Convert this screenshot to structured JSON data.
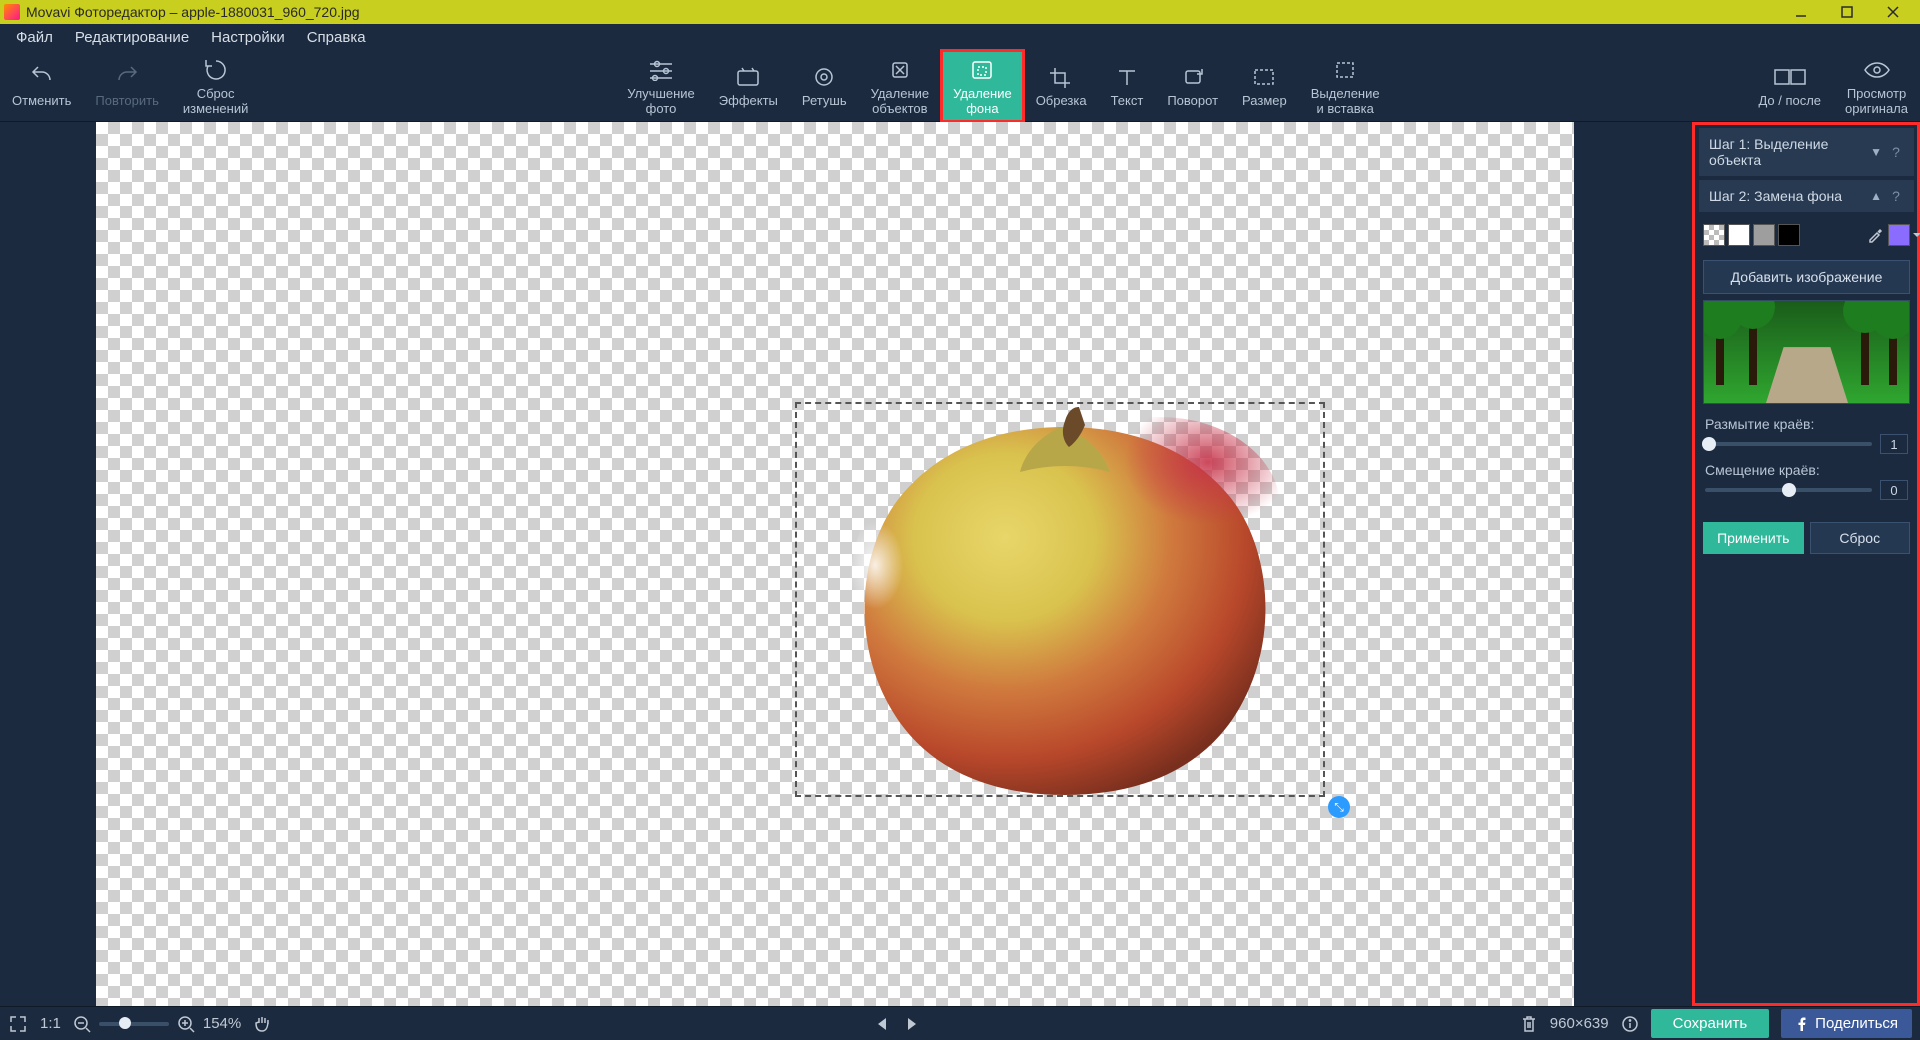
{
  "title": "Movavi Фоторедактор – apple-1880031_960_720.jpg",
  "menu": {
    "file": "Файл",
    "edit": "Редактирование",
    "settings": "Настройки",
    "help": "Справка"
  },
  "toolbar": {
    "undo": "Отменить",
    "redo": "Повторить",
    "reset": "Сброс\nизменений",
    "enhance": "Улучшение\nфото",
    "effects": "Эффекты",
    "retouch": "Ретушь",
    "removeObj": "Удаление\nобъектов",
    "removeBg": "Удаление\nфона",
    "crop": "Обрезка",
    "text": "Текст",
    "rotate": "Поворот",
    "resize": "Размер",
    "selectInsert": "Выделение\nи вставка",
    "beforeAfter": "До / после",
    "viewOrig": "Просмотр\nоригинала"
  },
  "panel": {
    "step1": "Шаг 1: Выделение объекта",
    "step2": "Шаг 2: Замена фона",
    "addImage": "Добавить изображение",
    "blurLabel": "Размытие краёв:",
    "blurValue": "1",
    "shiftLabel": "Смещение краёв:",
    "shiftValue": "0",
    "apply": "Применить",
    "reset": "Сброс",
    "swatches": {
      "white": "#ffffff",
      "gray": "#9e9e9e",
      "black": "#000000"
    },
    "pickerColor": "#8a6cff"
  },
  "status": {
    "scale11": "1:1",
    "zoom": "154%",
    "dimensions": "960×639",
    "save": "Сохранить",
    "share": "Поделиться"
  }
}
